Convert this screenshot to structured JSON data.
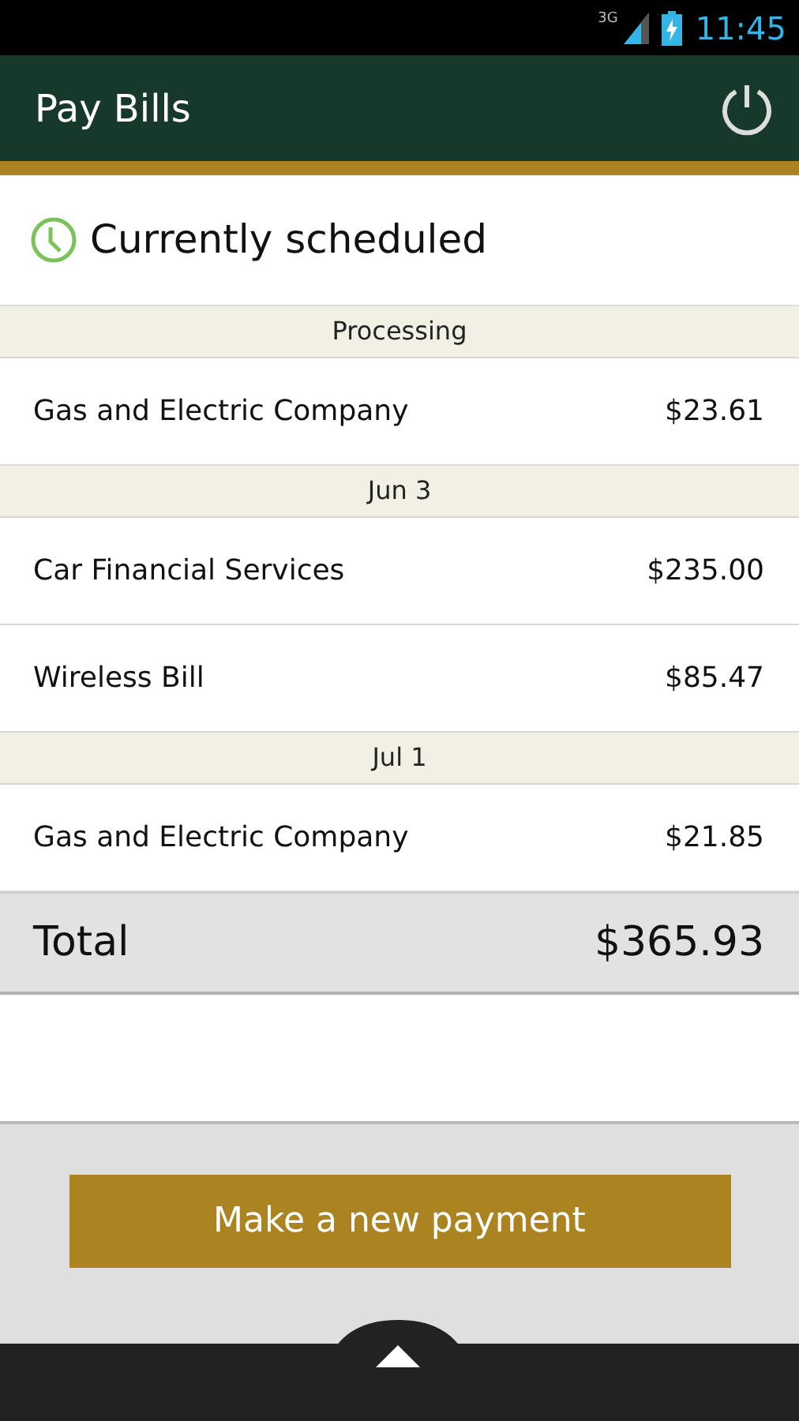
{
  "status_bar": {
    "network": "3G",
    "time": "11:45"
  },
  "app_bar": {
    "title": "Pay Bills"
  },
  "heading": "Currently scheduled",
  "groups": [
    {
      "label": "Processing",
      "payments": [
        {
          "payee": "Gas and Electric Company",
          "amount": "$23.61"
        }
      ]
    },
    {
      "label": "Jun 3",
      "payments": [
        {
          "payee": "Car Financial Services",
          "amount": "$235.00"
        },
        {
          "payee": "Wireless Bill",
          "amount": "$85.47"
        }
      ]
    },
    {
      "label": "Jul 1",
      "payments": [
        {
          "payee": "Gas and Electric Company",
          "amount": "$21.85"
        }
      ]
    }
  ],
  "total": {
    "label": "Total",
    "amount": "$365.93"
  },
  "buttons": [
    "Make a new payment"
  ]
}
